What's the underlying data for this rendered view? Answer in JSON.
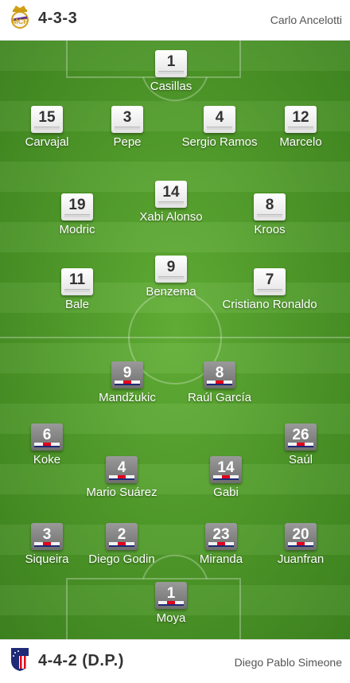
{
  "home": {
    "formation": "4-3-3",
    "coach": "Carlo Ancelotti",
    "crest_icon": "real-madrid-crest",
    "players": [
      {
        "number": "1",
        "name": "Casillas"
      },
      {
        "number": "15",
        "name": "Carvajal"
      },
      {
        "number": "3",
        "name": "Pepe"
      },
      {
        "number": "4",
        "name": "Sergio Ramos"
      },
      {
        "number": "12",
        "name": "Marcelo"
      },
      {
        "number": "19",
        "name": "Modric"
      },
      {
        "number": "14",
        "name": "Xabi Alonso"
      },
      {
        "number": "8",
        "name": "Kroos"
      },
      {
        "number": "11",
        "name": "Bale"
      },
      {
        "number": "9",
        "name": "Benzema"
      },
      {
        "number": "7",
        "name": "Cristiano Ronaldo"
      }
    ]
  },
  "away": {
    "formation": "4-4-2 (D.P.)",
    "coach": "Diego Pablo Simeone",
    "crest_icon": "atletico-madrid-crest",
    "players": [
      {
        "number": "9",
        "name": "Mandžukic"
      },
      {
        "number": "8",
        "name": "Raúl García"
      },
      {
        "number": "6",
        "name": "Koke"
      },
      {
        "number": "26",
        "name": "Saúl"
      },
      {
        "number": "4",
        "name": "Mario Suárez"
      },
      {
        "number": "14",
        "name": "Gabi"
      },
      {
        "number": "3",
        "name": "Siqueira"
      },
      {
        "number": "2",
        "name": "Diego Godin"
      },
      {
        "number": "23",
        "name": "Miranda"
      },
      {
        "number": "20",
        "name": "Juanfran"
      },
      {
        "number": "1",
        "name": "Moya"
      }
    ]
  },
  "colors": {
    "pitch": "#4f9a29",
    "home_shirt": "#ffffff",
    "away_shirt": "#7f7f7f",
    "away_stripe_red": "#e3001b",
    "away_stripe_blue": "#1e2a78"
  }
}
